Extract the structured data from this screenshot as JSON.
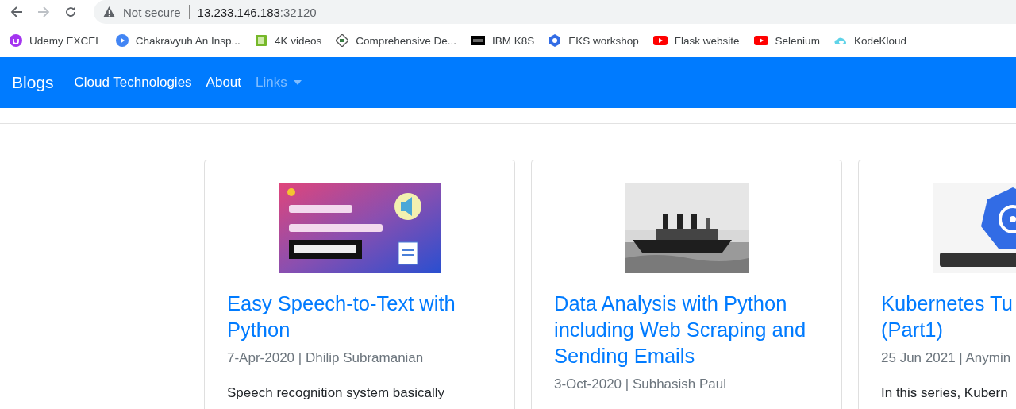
{
  "browser": {
    "security": "Not secure",
    "host": "13.233.146.183",
    "port": ":32120"
  },
  "bookmarks": [
    {
      "label": "Udemy EXCEL"
    },
    {
      "label": "Chakravyuh An Insp..."
    },
    {
      "label": "4K videos"
    },
    {
      "label": "Comprehensive De..."
    },
    {
      "label": "IBM K8S"
    },
    {
      "label": "EKS workshop"
    },
    {
      "label": "Flask website"
    },
    {
      "label": "Selenium"
    },
    {
      "label": "KodeKloud"
    }
  ],
  "navbar": {
    "brand": "Blogs",
    "items": [
      {
        "label": "Cloud Technologies",
        "active": true,
        "dropdown": false
      },
      {
        "label": "About",
        "active": true,
        "dropdown": false
      },
      {
        "label": "Links",
        "active": false,
        "dropdown": true
      }
    ]
  },
  "posts": [
    {
      "title": "Easy Speech-to-Text with Python",
      "meta": "7-Apr-2020 | Dhilip Subramanian",
      "excerpt": "Speech recognition system basically"
    },
    {
      "title": "Data Analysis with Python including Web Scraping and Sending Emails",
      "meta": "3-Oct-2020 | Subhasish Paul"
    },
    {
      "title": "Kubernetes Tu\n(Part1)",
      "meta": "25 Jun 2021 | Anymin",
      "excerpt": "In this series, Kubern"
    }
  ]
}
